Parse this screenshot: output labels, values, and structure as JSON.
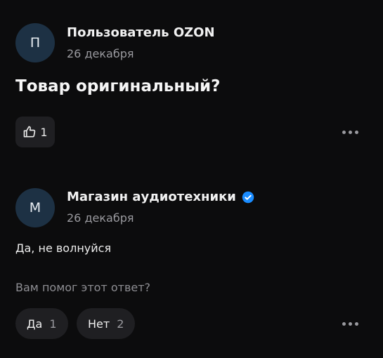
{
  "question": {
    "avatar_letter": "П",
    "author": "Пользователь OZON",
    "date": "26 декабря",
    "text": "Товар оригинальный?",
    "likes": "1"
  },
  "answer": {
    "avatar_letter": "М",
    "author": "Магазин аудиотехники",
    "verified": true,
    "date": "26 декабря",
    "text": "Да, не волнуйся",
    "helpful_prompt": "Вам помог этот ответ?",
    "yes_label": "Да",
    "yes_count": "1",
    "no_label": "Нет",
    "no_count": "2"
  },
  "colors": {
    "background": "#0c0c0d",
    "avatar_bg": "#1d3144",
    "button_bg": "#1f1f22",
    "verified_blue": "#1a8cff"
  },
  "icons": [
    "thumbs-up-icon",
    "verified-badge-icon",
    "more-options-icon"
  ]
}
